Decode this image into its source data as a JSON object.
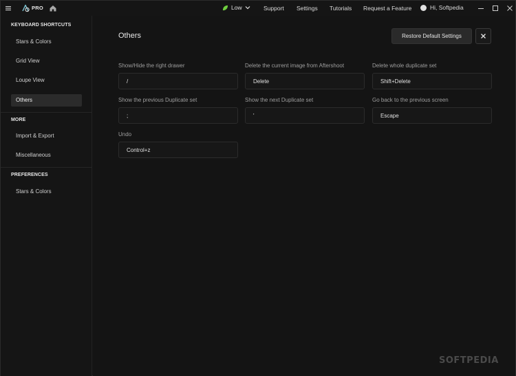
{
  "titlebar": {
    "pro_label": "PRO",
    "quality_label": "Low",
    "nav": [
      "Support",
      "Settings",
      "Tutorials",
      "Request a Feature"
    ],
    "user_greeting": "Hi, Softpedia"
  },
  "sidebar": {
    "sections": [
      {
        "title": "KEYBOARD SHORTCUTS",
        "items": [
          "Stars & Colors",
          "Grid View",
          "Loupe View",
          "Others"
        ]
      },
      {
        "title": "MORE",
        "items": [
          "Import & Export",
          "Miscellaneous"
        ]
      },
      {
        "title": "PREFERENCES",
        "items": [
          "Stars & Colors"
        ]
      }
    ],
    "active_item": "Others"
  },
  "main": {
    "title": "Others",
    "restore_label": "Restore Default Settings",
    "shortcuts": [
      {
        "label": "Show/Hide the right drawer",
        "value": "/"
      },
      {
        "label": "Delete the current image from Aftershoot",
        "value": "Delete"
      },
      {
        "label": "Delete whole duplicate set",
        "value": "Shift+Delete"
      },
      {
        "label": "Show the previous Duplicate set",
        "value": ";"
      },
      {
        "label": "Show the next Duplicate set",
        "value": "'"
      },
      {
        "label": "Go back to the previous screen",
        "value": "Escape"
      },
      {
        "label": "Undo",
        "value": "Control+z"
      }
    ]
  },
  "watermark": "SOFTPEDIA",
  "colors": {
    "background": "#141414",
    "sidebar_active": "#2b2b2b",
    "leaf_accent": "#6fcf3f"
  },
  "icons": [
    "menu-icon",
    "logo-icon",
    "home-icon",
    "leaf-icon",
    "chevron-down-icon",
    "avatar",
    "minimize-icon",
    "maximize-icon",
    "close-icon"
  ]
}
